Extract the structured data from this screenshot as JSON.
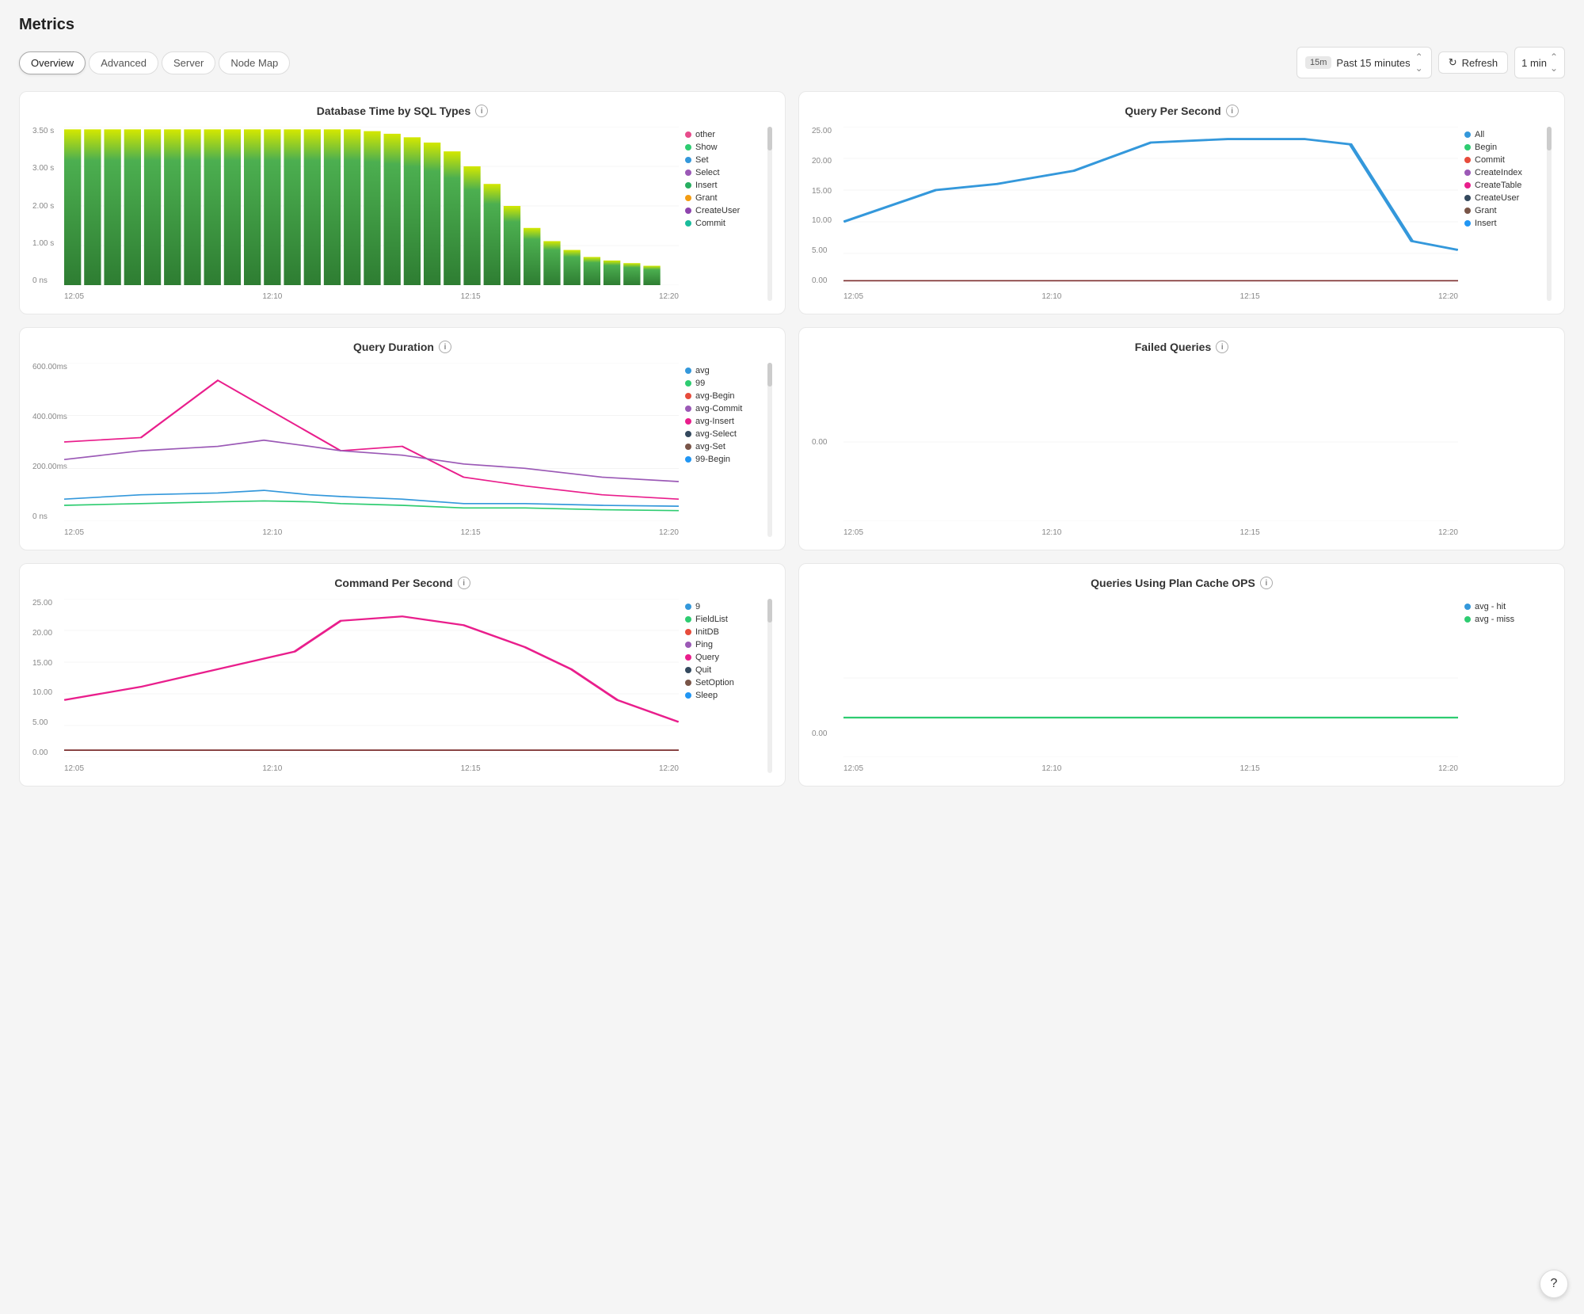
{
  "page": {
    "title": "Metrics"
  },
  "tabs": [
    {
      "id": "overview",
      "label": "Overview",
      "active": true
    },
    {
      "id": "advanced",
      "label": "Advanced",
      "active": false
    },
    {
      "id": "server",
      "label": "Server",
      "active": false
    },
    {
      "id": "node-map",
      "label": "Node Map",
      "active": false
    }
  ],
  "toolbar": {
    "time_badge": "15m",
    "time_label": "Past 15 minutes",
    "refresh_label": "Refresh",
    "interval_label": "1 min"
  },
  "charts": [
    {
      "id": "db-time",
      "title": "Database Time by SQL Types",
      "type": "bar",
      "y_labels": [
        "3.50 s",
        "3.00 s",
        "2.00 s",
        "1.00 s",
        "0 ns"
      ],
      "x_labels": [
        "12:05",
        "12:10",
        "12:15",
        "12:20"
      ],
      "legend": [
        {
          "label": "other",
          "color": "#e74c8b"
        },
        {
          "label": "Show",
          "color": "#2ecc71"
        },
        {
          "label": "Set",
          "color": "#3498db"
        },
        {
          "label": "Select",
          "color": "#9b59b6"
        },
        {
          "label": "Insert",
          "color": "#27ae60"
        },
        {
          "label": "Grant",
          "color": "#f39c12"
        },
        {
          "label": "CreateUser",
          "color": "#8e44ad"
        },
        {
          "label": "Commit",
          "color": "#1abc9c"
        }
      ]
    },
    {
      "id": "query-per-second",
      "title": "Query Per Second",
      "type": "line",
      "y_labels": [
        "25.00",
        "20.00",
        "15.00",
        "10.00",
        "5.00",
        "0.00"
      ],
      "x_labels": [
        "12:05",
        "12:10",
        "12:15",
        "12:20"
      ],
      "legend": [
        {
          "label": "All",
          "color": "#3498db"
        },
        {
          "label": "Begin",
          "color": "#2ecc71"
        },
        {
          "label": "Commit",
          "color": "#e74c3c"
        },
        {
          "label": "CreateIndex",
          "color": "#9b59b6"
        },
        {
          "label": "CreateTable",
          "color": "#e91e8c"
        },
        {
          "label": "CreateUser",
          "color": "#34495e"
        },
        {
          "label": "Grant",
          "color": "#795548"
        },
        {
          "label": "Insert",
          "color": "#2196f3"
        }
      ]
    },
    {
      "id": "query-duration",
      "title": "Query Duration",
      "type": "line",
      "y_labels": [
        "600.00 ms",
        "400.00 ms",
        "200.00 ms",
        "0 ns"
      ],
      "x_labels": [
        "12:05",
        "12:10",
        "12:15",
        "12:20"
      ],
      "legend": [
        {
          "label": "avg",
          "color": "#3498db"
        },
        {
          "label": "99",
          "color": "#2ecc71"
        },
        {
          "label": "avg-Begin",
          "color": "#e74c3c"
        },
        {
          "label": "avg-Commit",
          "color": "#9b59b6"
        },
        {
          "label": "avg-Insert",
          "color": "#e91e8c"
        },
        {
          "label": "avg-Select",
          "color": "#34495e"
        },
        {
          "label": "avg-Set",
          "color": "#795548"
        },
        {
          "label": "99-Begin",
          "color": "#2196f3"
        }
      ]
    },
    {
      "id": "failed-queries",
      "title": "Failed Queries",
      "type": "line",
      "y_labels": [
        "",
        "",
        "0.00",
        ""
      ],
      "x_labels": [
        "12:05",
        "12:10",
        "12:15",
        "12:20"
      ],
      "legend": []
    },
    {
      "id": "command-per-second",
      "title": "Command Per Second",
      "type": "line",
      "y_labels": [
        "25.00",
        "20.00",
        "15.00",
        "10.00",
        "5.00",
        "0.00"
      ],
      "x_labels": [
        "12:05",
        "12:10",
        "12:15",
        "12:20"
      ],
      "legend": [
        {
          "label": "9",
          "color": "#3498db"
        },
        {
          "label": "FieldList",
          "color": "#2ecc71"
        },
        {
          "label": "InitDB",
          "color": "#e74c3c"
        },
        {
          "label": "Ping",
          "color": "#9b59b6"
        },
        {
          "label": "Query",
          "color": "#e91e8c"
        },
        {
          "label": "Quit",
          "color": "#34495e"
        },
        {
          "label": "SetOption",
          "color": "#795548"
        },
        {
          "label": "Sleep",
          "color": "#2196f3"
        }
      ]
    },
    {
      "id": "plan-cache-ops",
      "title": "Queries Using Plan Cache OPS",
      "type": "line",
      "y_labels": [
        "",
        "0.00",
        ""
      ],
      "x_labels": [
        "12:05",
        "12:10",
        "12:15",
        "12:20"
      ],
      "legend": [
        {
          "label": "avg - hit",
          "color": "#3498db"
        },
        {
          "label": "avg - miss",
          "color": "#2ecc71"
        }
      ]
    }
  ]
}
